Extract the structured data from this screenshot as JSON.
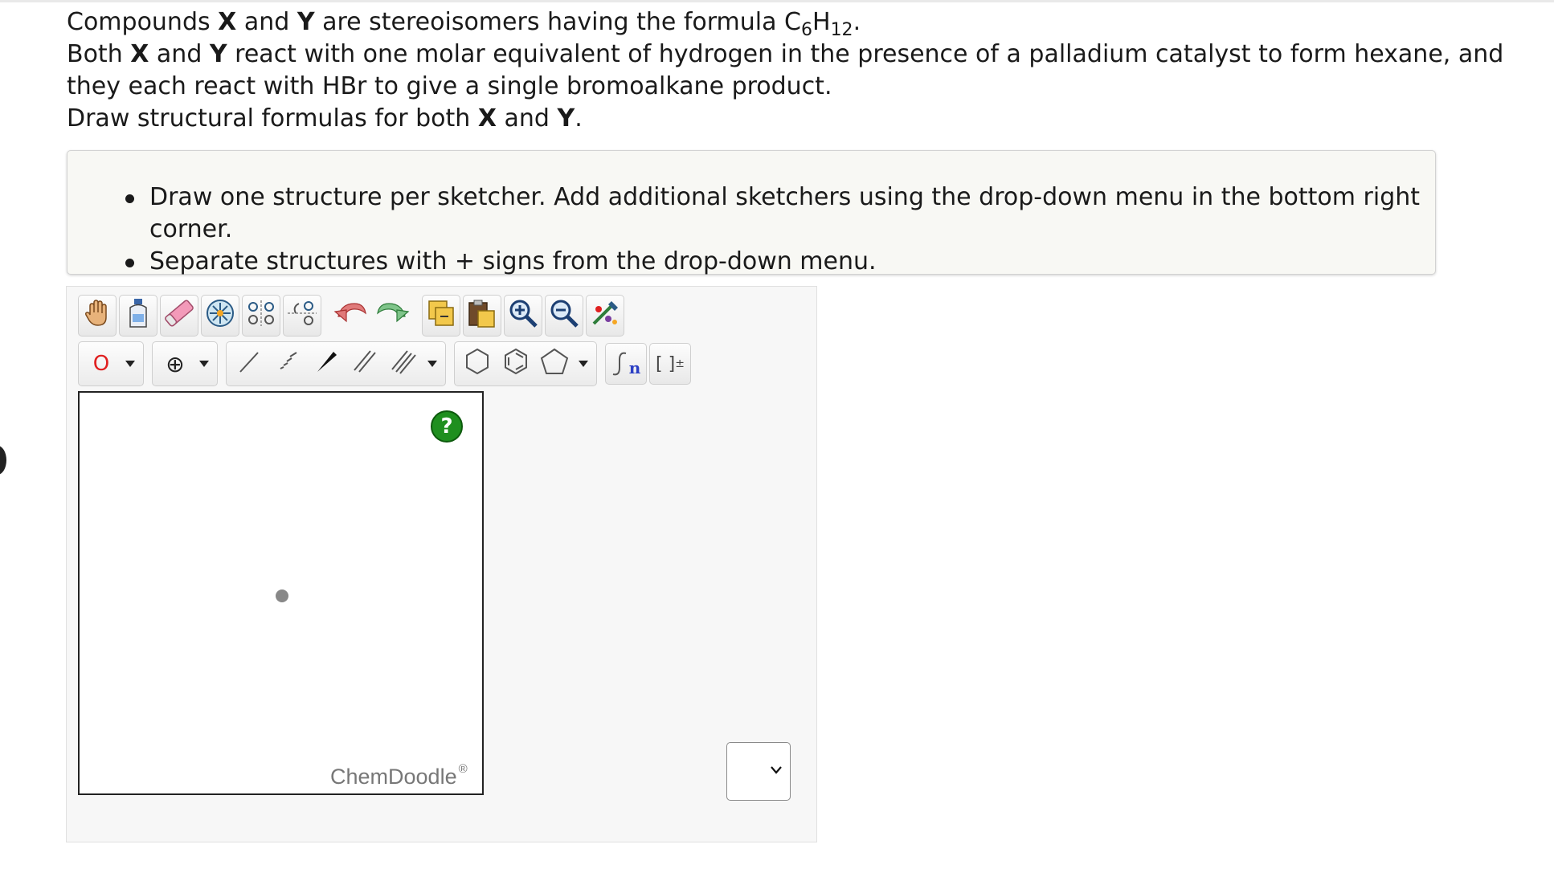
{
  "question": {
    "line1": {
      "a": "Compounds ",
      "x": "X",
      "b": " and ",
      "y": "Y",
      "c": " are stereoisomers having the formula C",
      "sub1": "6",
      "d": "H",
      "sub2": "12",
      "e": "."
    },
    "line2": {
      "a": "Both ",
      "x": "X",
      "b": " and ",
      "y": "Y",
      "c": " react with one molar equivalent of hydrogen in the presence of a palladium catalyst to form hexane, and they each react with HBr to give a single bromoalkane product."
    },
    "line3": {
      "a": "Draw structural formulas for both ",
      "x": "X",
      "b": " and ",
      "y": "Y",
      "c": "."
    }
  },
  "instructions": {
    "items": [
      "Draw one structure per sketcher. Add additional sketchers using the drop-down menu in the bottom right corner.",
      "Separate structures with + signs from the drop-down menu."
    ]
  },
  "toolbar": {
    "atom_label": "O",
    "charge_symbol": "⊕",
    "sgroup_symbol": "n",
    "bracket_label": "[ ]",
    "bracket_sup": "±"
  },
  "sketcher": {
    "help_label": "?",
    "brand": "ChemDoodle",
    "brand_mark": "®"
  },
  "icons": [
    "hand-icon",
    "clear-bottle-icon",
    "eraser-icon",
    "center-icon",
    "flip-icon",
    "flip-vertical-icon",
    "undo-icon",
    "redo-icon",
    "copy-icon",
    "paste-icon",
    "zoom-in-icon",
    "zoom-out-icon",
    "clean-icon",
    "single-bond-icon",
    "recessed-bond-icon",
    "wedge-bond-icon",
    "double-bond-icon",
    "triple-bond-icon",
    "cyclohexane-icon",
    "benzene-icon",
    "cyclopentane-icon",
    "sgroup-icon",
    "chevron-down-icon"
  ],
  "colors": {
    "help_green": "#1f8f1f",
    "brand_gray": "#777777",
    "atom_red": "#e02020"
  }
}
